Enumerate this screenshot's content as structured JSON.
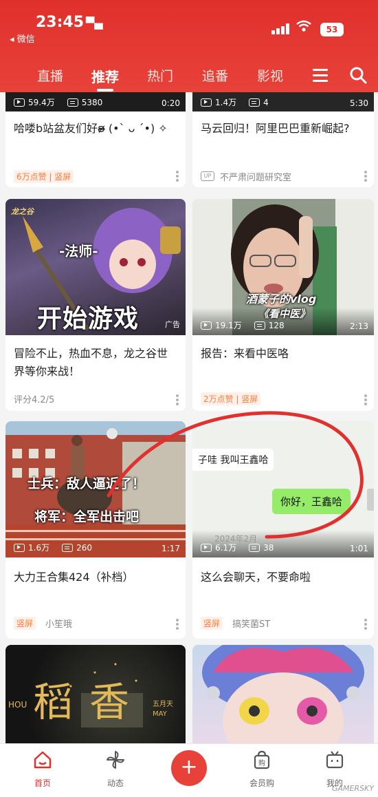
{
  "status_bar": {
    "time": "23:45",
    "back_app": "微信",
    "battery": "53"
  },
  "top_tabs": [
    "直播",
    "推荐",
    "热门",
    "追番",
    "影视"
  ],
  "cards": [
    {
      "plays": "59.4万",
      "danmaku": "5380",
      "duration": "0:20",
      "title": "哈喽b站盆友们好ʚ̴̶̷̷ (•ˋ ᴗ ˊ•) ✧",
      "tag": "6万点赞 | 竖屏"
    },
    {
      "plays": "1.4万",
      "danmaku": "4",
      "duration": "5:30",
      "title": "马云回归！阿里巴巴重新崛起?",
      "uploader": "不严肃问题研究室",
      "up_badge": "UP"
    },
    {
      "thumb_caption_big": "开始游戏",
      "thumb_caption_small": "-法师-",
      "logo_text": "龙之谷",
      "ad_label": "广告",
      "title": "冒险不止，热血不息，龙之谷世界等你来战！",
      "rating": "评分4.2/5"
    },
    {
      "plays": "19.1万",
      "danmaku": "128",
      "duration": "2:13",
      "thumb_caption_1": "酒蒙子的vlog",
      "thumb_caption_2": "《看中医》",
      "title": "报告：来看中医咯",
      "tag": "2万点赞 | 竖屏"
    },
    {
      "plays": "1.6万",
      "danmaku": "260",
      "duration": "1:17",
      "thumb_caption_1": "士兵：敌人逼近了！",
      "thumb_caption_2": "将军：全军出击吧",
      "title": "大力王合集424（补档）",
      "tag": "竖屏",
      "uploader": "小笙哦"
    },
    {
      "plays": "6.1万",
      "danmaku": "38",
      "duration": "1:01",
      "chat_left": "子哇 我叫王鑫哈",
      "chat_right": "你好，王鑫哈",
      "chat_date": "2024年2月",
      "title": "这么会聊天，不要命啦",
      "tag": "竖屏",
      "uploader": "搞笑菌ST"
    },
    {
      "thumb_caption_1": "稻香",
      "thumb_caption_2": "HOU",
      "thumb_caption_3": "五月天 MAY"
    },
    {}
  ],
  "bottom_nav": [
    {
      "label": "首页",
      "icon": "home-icon"
    },
    {
      "label": "动态",
      "icon": "pinwheel-icon"
    },
    {
      "label": "会员购",
      "icon": "shopping-bag-icon"
    },
    {
      "label": "我的",
      "icon": "tv-icon"
    }
  ],
  "watermark": "GAMERSKY",
  "colors": {
    "brand_red": "#e0302c",
    "tag_orange": "#ff7a3a",
    "annotation_red": "#e0312f"
  }
}
